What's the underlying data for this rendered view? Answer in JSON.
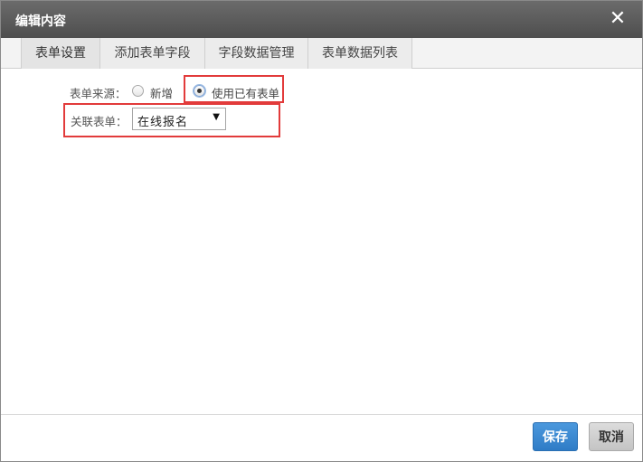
{
  "dialog": {
    "title": "编辑内容",
    "close_glyph": "✕",
    "close_icon": "close-icon"
  },
  "tabs": [
    {
      "label": "表单设置",
      "active": true
    },
    {
      "label": "添加表单字段",
      "active": false
    },
    {
      "label": "字段数据管理",
      "active": false
    },
    {
      "label": "表单数据列表",
      "active": false
    }
  ],
  "form": {
    "source_label": "表单来源：",
    "source_options": [
      {
        "label": "新增",
        "checked": false
      },
      {
        "label": "使用已有表单",
        "checked": true
      }
    ],
    "linked_form_label": "关联表单：",
    "linked_form_value": "在线报名",
    "dropdown_arrow": "▼"
  },
  "footer": {
    "save_label": "保存",
    "cancel_label": "取消"
  },
  "colors": {
    "primary": "#2f7cc6",
    "highlight": "#e23b3b",
    "titlebar": "#555555"
  }
}
